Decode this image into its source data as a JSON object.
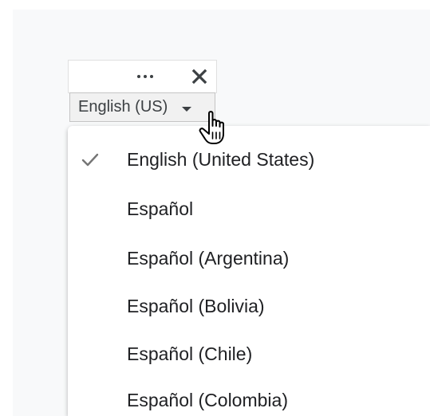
{
  "language_widget": {
    "more_options_icon": "more-horiz-icon",
    "close_icon": "close-icon",
    "selected_language": "English (US)"
  },
  "dropdown": {
    "items": [
      {
        "label": "English (United States)",
        "selected": true
      },
      {
        "label": "Español",
        "selected": false
      },
      {
        "label": "Español (Argentina)",
        "selected": false
      },
      {
        "label": "Español (Bolivia)",
        "selected": false
      },
      {
        "label": "Español (Chile)",
        "selected": false
      },
      {
        "label": "Español (Colombia)",
        "selected": false
      }
    ]
  },
  "colors": {
    "text": "#202124",
    "icon": "#3c4043",
    "check": "#757575",
    "select_bg": "#f1f1f1"
  }
}
